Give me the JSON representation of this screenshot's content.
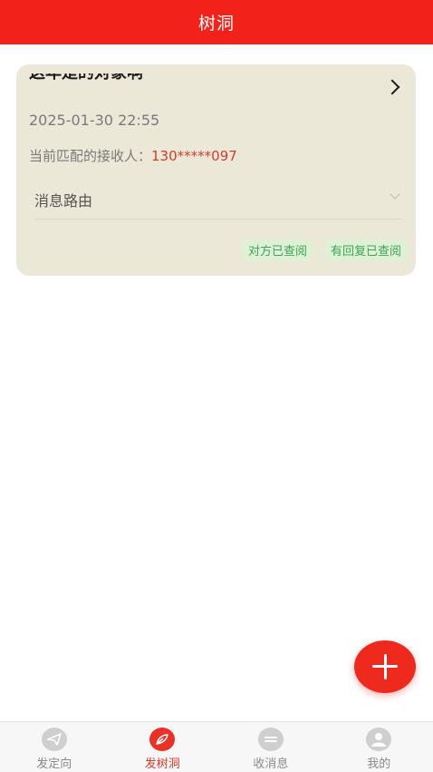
{
  "header": {
    "title": "树洞"
  },
  "card": {
    "title": "这年是的对象啊",
    "date": "2025-01-30 22:55",
    "receiver_label": "当前匹配的接收人：",
    "receiver_value": "130*****097",
    "route_label": "消息路由",
    "tags": [
      "对方已查阅",
      "有回复已查阅"
    ]
  },
  "fab": {
    "icon": "plus-icon"
  },
  "tabbar": {
    "items": [
      {
        "label": "发定向",
        "icon": "paper-plane-icon",
        "active": false
      },
      {
        "label": "发树洞",
        "icon": "leaf-icon",
        "active": true
      },
      {
        "label": "收消息",
        "icon": "message-icon",
        "active": false
      },
      {
        "label": "我的",
        "icon": "user-icon",
        "active": false
      }
    ]
  },
  "colors": {
    "accent": "#f2221b",
    "card_bg": "#ece8d8",
    "tag_bg": "#dff0d5",
    "tag_text": "#3aa55a"
  }
}
